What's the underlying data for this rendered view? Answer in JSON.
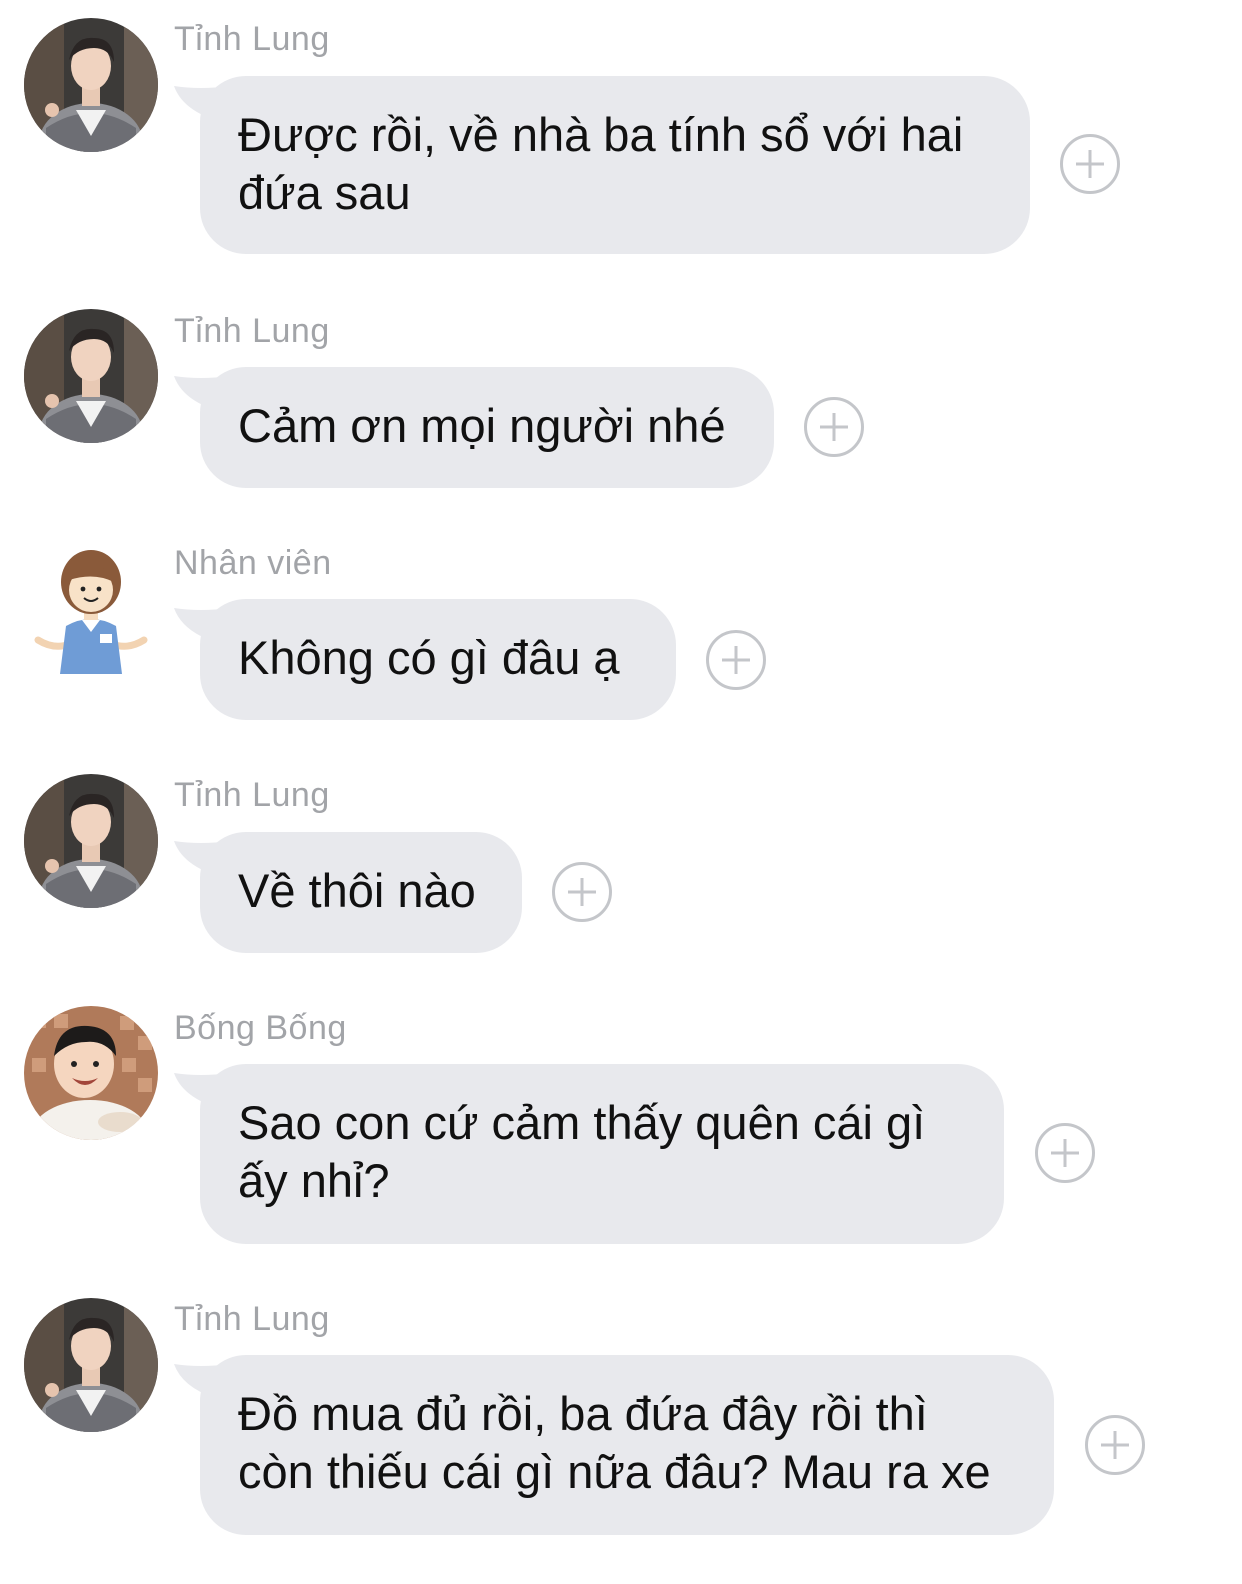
{
  "messages": [
    {
      "sender": "Tỉnh Lung",
      "text": "Được rồi, về nhà ba tính sổ với hai đứa sau",
      "avatar": "man-avatar"
    },
    {
      "sender": "Tỉnh Lung",
      "text": "Cảm ơn mọi người nhé",
      "avatar": "man-avatar"
    },
    {
      "sender": "Nhân viên",
      "text": "Không có gì đâu ạ",
      "avatar": "staff-cartoon-avatar"
    },
    {
      "sender": "Tỉnh Lung",
      "text": "Về thôi nào",
      "avatar": "man-avatar"
    },
    {
      "sender": "Bống Bống",
      "text": "Sao con cứ cảm thấy quên cái gì ấy nhỉ?",
      "avatar": "child-avatar"
    },
    {
      "sender": "Tỉnh Lung",
      "text": "Đồ mua đủ rồi, ba đứa đây rồi thì còn thiếu cái gì nữa đâu? Mau ra xe",
      "avatar": "man-avatar"
    }
  ],
  "icons": {
    "add_reaction": "plus-circle-icon"
  },
  "colors": {
    "bubble": "#e8e9ed",
    "sender_name": "#a2a4a8",
    "icon_stroke": "#c4c6ca"
  }
}
